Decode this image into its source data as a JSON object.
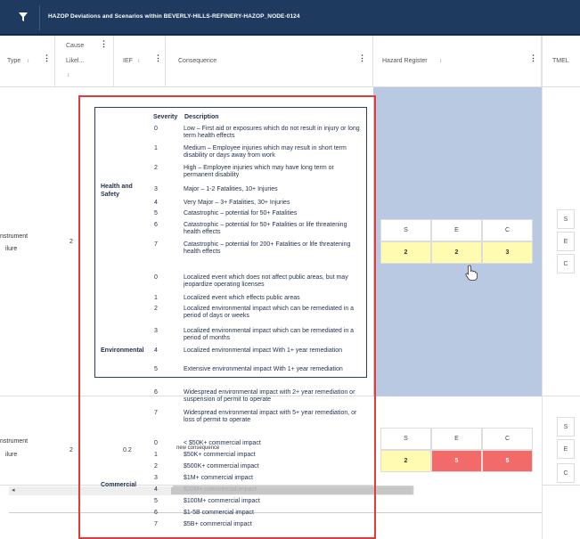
{
  "titlebar": {
    "title": "HAZOP Deviations and Scenarios within BEVERLY-HILLS-REFINERY-HAZOP_NODE-0124"
  },
  "columns": {
    "type": "Type",
    "cause_likelihood_line1": "Cause",
    "cause_likelihood_line2": "Likel...",
    "cause_likelihood_line3": "↕",
    "ief": "IEF",
    "consequence": "Consequence",
    "hazard_register": "Hazard Register",
    "tmel": "TMEL"
  },
  "rows": [
    {
      "type_line1": "nstrument",
      "type_line2": "ilure",
      "likelihood": "2",
      "ief": "",
      "hazard": {
        "headers": [
          "S",
          "E",
          "C"
        ],
        "values": [
          "2",
          "2",
          "3"
        ]
      },
      "tmel": [
        "S",
        "E",
        "C"
      ]
    },
    {
      "type_line1": "nstrument",
      "type_line2": "ilure",
      "likelihood": "2",
      "ief": "0.2",
      "hazard": {
        "headers": [
          "S",
          "E",
          "C"
        ],
        "values": [
          "2",
          "5",
          "5"
        ]
      },
      "tmel": [
        "S",
        "E",
        "C"
      ]
    }
  ],
  "severity_popup": {
    "header_severity": "Severity",
    "header_description": "Description",
    "health_safety_line1": "Health and",
    "health_safety_line2": "Safety",
    "environmental": "Environmental",
    "commercial": "Commercial",
    "health": [
      {
        "sev": "0",
        "desc": "Low – First aid or exposures which do not result in injury or long term health effects"
      },
      {
        "sev": "1",
        "desc": "Medium – Employee injuries which may result in short term disability or days away from work"
      },
      {
        "sev": "2",
        "desc": "High – Employee injuries which may have long term or permanent disability"
      },
      {
        "sev": "3",
        "desc": "Major – 1-2 Fatalities, 10+ Injuries"
      },
      {
        "sev": "4",
        "desc": "Very Major – 3+ Fatalities, 30+ Injuries"
      },
      {
        "sev": "5",
        "desc": "Catastrophic – potential for 50+ Fatalities"
      },
      {
        "sev": "6",
        "desc": "Catastrophic – potential for 50+ Fatalities or life threatening health effects"
      },
      {
        "sev": "7",
        "desc": "Catastrophic – potential for 200+ Fatalities or life threatening health effects"
      }
    ],
    "environmental_items": [
      {
        "sev": "0",
        "desc": "Localized event which does not affect public areas, but may jeopardize operating licenses"
      },
      {
        "sev": "1",
        "desc": "Localized event which effects public areas"
      },
      {
        "sev": "2",
        "desc": "Localized environmental impact which can be remediated in a period of days or weeks"
      },
      {
        "sev": "3",
        "desc": "Localized environmental impact which can be remediated in a period of months"
      },
      {
        "sev": "4",
        "desc": "Localized environmental impact With 1+ year remediation"
      },
      {
        "sev": "5",
        "desc": "Extensive environmental impact With 1+ year remediation"
      },
      {
        "sev": "6",
        "desc": "Widespread environmental impact with 2+ year remediation or suspension of permit to operate"
      },
      {
        "sev": "7",
        "desc": "Widespread environmental impact with 5+ year remediation, or loss of permit to operate"
      }
    ],
    "commercial_items": [
      {
        "sev": "0",
        "desc": "< $50K+ commercial impact"
      },
      {
        "sev": "1",
        "desc": "$50K+ commercial impact"
      },
      {
        "sev": "2",
        "desc": "$500K+ commercial impact"
      },
      {
        "sev": "3",
        "desc": "$1M+ commercial impact"
      },
      {
        "sev": "4",
        "desc": "$20M+ commercial impact"
      },
      {
        "sev": "5",
        "desc": "$100M+ commercial impact"
      },
      {
        "sev": "6",
        "desc": "$1-5B commercial impact"
      },
      {
        "sev": "7",
        "desc": "$5B+ commercial impact"
      }
    ]
  },
  "new_consequence_label": "new consequence",
  "scroll_arrow": "◂",
  "colors": {
    "titlebar": "#1e3a5f",
    "hazard_bg": "#b8c9e1",
    "yellow": "#fffbb0",
    "red": "#f26a6a",
    "highlight_frame": "#e03c3c"
  }
}
